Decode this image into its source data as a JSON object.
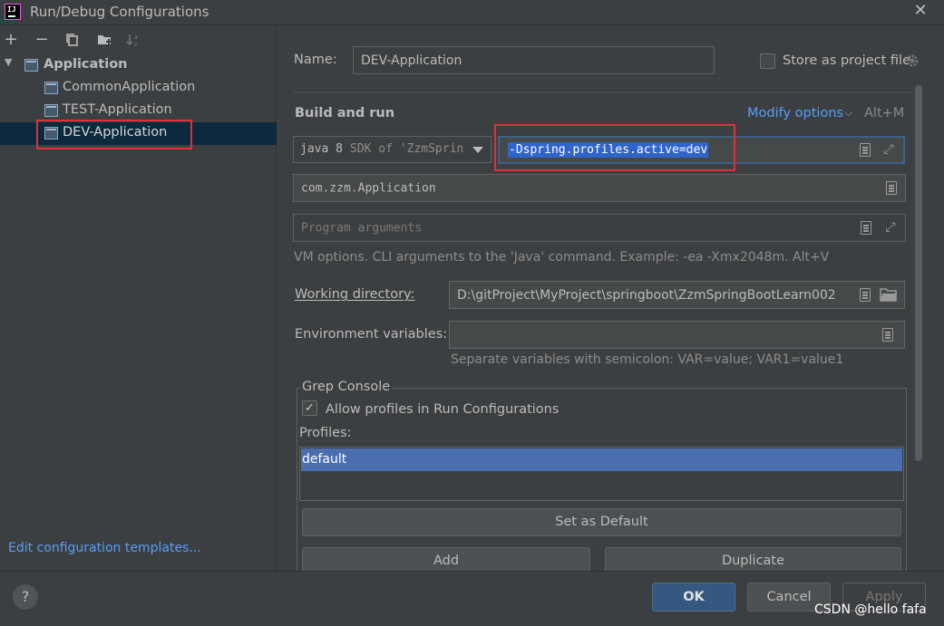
{
  "window": {
    "title": "Run/Debug Configurations",
    "logo_text": "IJ"
  },
  "left": {
    "toolbar": [
      "+",
      "−",
      "copy-icon",
      "folder-add-icon",
      "sort-icon"
    ],
    "tree": {
      "root": "Application",
      "items": [
        "CommonApplication",
        "TEST-Application",
        "DEV-Application"
      ],
      "selected": "DEV-Application"
    },
    "edit_templates": "Edit configuration templates..."
  },
  "right": {
    "name_label": "Name:",
    "name_value": "DEV-Application",
    "store_label": "Store as project file",
    "section_title": "Build and run",
    "modify_options": "Modify options",
    "modify_shortcut": "Alt+M",
    "jdk_main": "java 8",
    "jdk_sub": "SDK of 'ZzmSprin",
    "vm_options": "-Dspring.profiles.active=dev",
    "main_class": "com.zzm.Application",
    "program_args_placeholder": "Program arguments",
    "vm_hint": "VM options. CLI arguments to the 'Java' command. Example: -ea -Xmx2048m. Alt+V",
    "working_dir_label": "Working directory:",
    "working_dir_value": "D:\\gitProject\\MyProject\\springboot\\ZzmSpringBootLearn002",
    "env_label": "Environment variables:",
    "env_value": "",
    "env_hint": "Separate variables with semicolon: VAR=value; VAR1=value1",
    "grep": {
      "title": "Grep Console",
      "allow_label": "Allow profiles in Run Configurations",
      "allow_checked": true,
      "profiles_label": "Profiles:",
      "profiles": [
        "default"
      ],
      "set_default": "Set as Default",
      "add": "Add",
      "duplicate": "Duplicate"
    }
  },
  "footer": {
    "help": "?",
    "ok": "OK",
    "cancel": "Cancel",
    "apply": "Apply"
  },
  "watermark": "CSDN @hello fafa",
  "colors": {
    "background": "#3c3f41",
    "selection": "#0d293e",
    "link": "#589df6",
    "highlight_box": "#e0313b",
    "profile_selected": "#4b6eaf",
    "ok_button": "#365880"
  }
}
